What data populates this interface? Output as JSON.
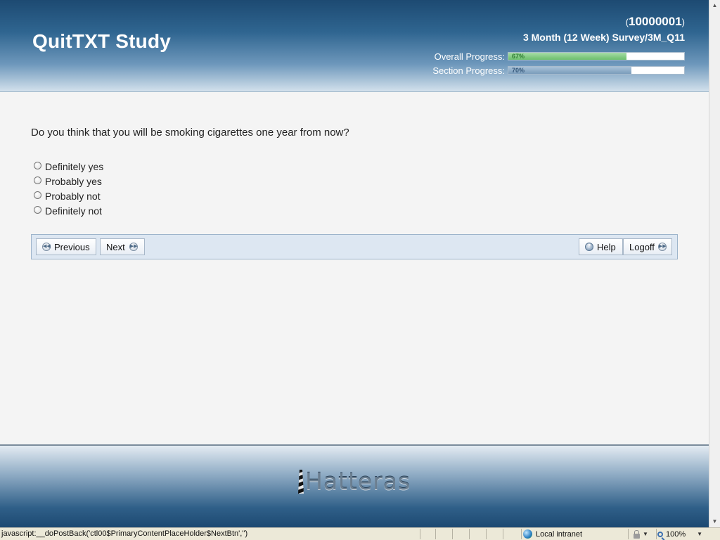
{
  "header": {
    "title": "QuitTXT Study",
    "participant_open": "(",
    "participant_id": "10000001",
    "participant_close": ")",
    "survey_path": "3 Month (12 Week) Survey/3M_Q11",
    "overall_progress": {
      "label": "Overall Progress:",
      "percent_text": "67%",
      "value": 0.67
    },
    "section_progress": {
      "label": "Section Progress:",
      "percent_text": "70%",
      "value": 0.7
    }
  },
  "question": {
    "text": "Do you think that you will be smoking cigarettes one year from now?",
    "options": [
      "Definitely yes",
      "Probably yes",
      "Probably not",
      "Definitely not"
    ]
  },
  "nav": {
    "previous_label": "Previous",
    "next_label": "Next",
    "help_label": "Help",
    "logoff_label": "Logoff"
  },
  "footer": {
    "logo_text": "Hatteras"
  },
  "status_bar": {
    "url": "javascript:__doPostBack('ctl00$PrimaryContentPlaceHolder$NextBtn','')",
    "zone": "Local intranet",
    "zoom": "100%"
  },
  "colors": {
    "header_top": "#1d4a72",
    "overall_fill": "#6cbf6c",
    "section_fill": "#7a9cbb",
    "navbar_bg": "#dde7f2"
  }
}
